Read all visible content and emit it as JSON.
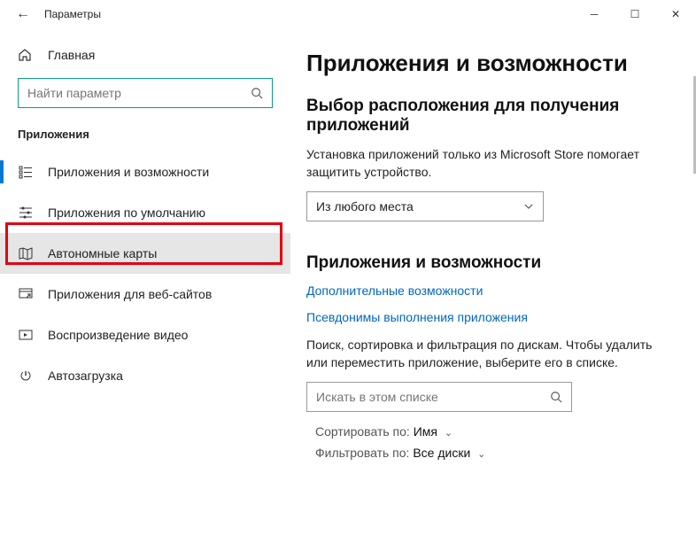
{
  "titlebar": {
    "title": "Параметры"
  },
  "sidebar": {
    "home_label": "Главная",
    "search_placeholder": "Найти параметр",
    "section": "Приложения",
    "items": [
      {
        "label": "Приложения и возможности"
      },
      {
        "label": "Приложения по умолчанию"
      },
      {
        "label": "Автономные карты"
      },
      {
        "label": "Приложения для веб-сайтов"
      },
      {
        "label": "Воспроизведение видео"
      },
      {
        "label": "Автозагрузка"
      }
    ]
  },
  "main": {
    "heading": "Приложения и возможности",
    "source_heading": "Выбор расположения для получения приложений",
    "source_body": "Установка приложений только из Microsoft Store помогает защитить устройство.",
    "source_value": "Из любого места",
    "apps_heading": "Приложения и возможности",
    "link_optional": "Дополнительные возможности",
    "link_aliases": "Псевдонимы выполнения приложения",
    "apps_body": "Поиск, сортировка и фильтрация по дискам. Чтобы удалить или переместить приложение, выберите его в списке.",
    "filter_placeholder": "Искать в этом списке",
    "sort_label": "Сортировать по:",
    "sort_value": "Имя",
    "filter_label": "Фильтровать по:",
    "filter_value": "Все диски"
  }
}
